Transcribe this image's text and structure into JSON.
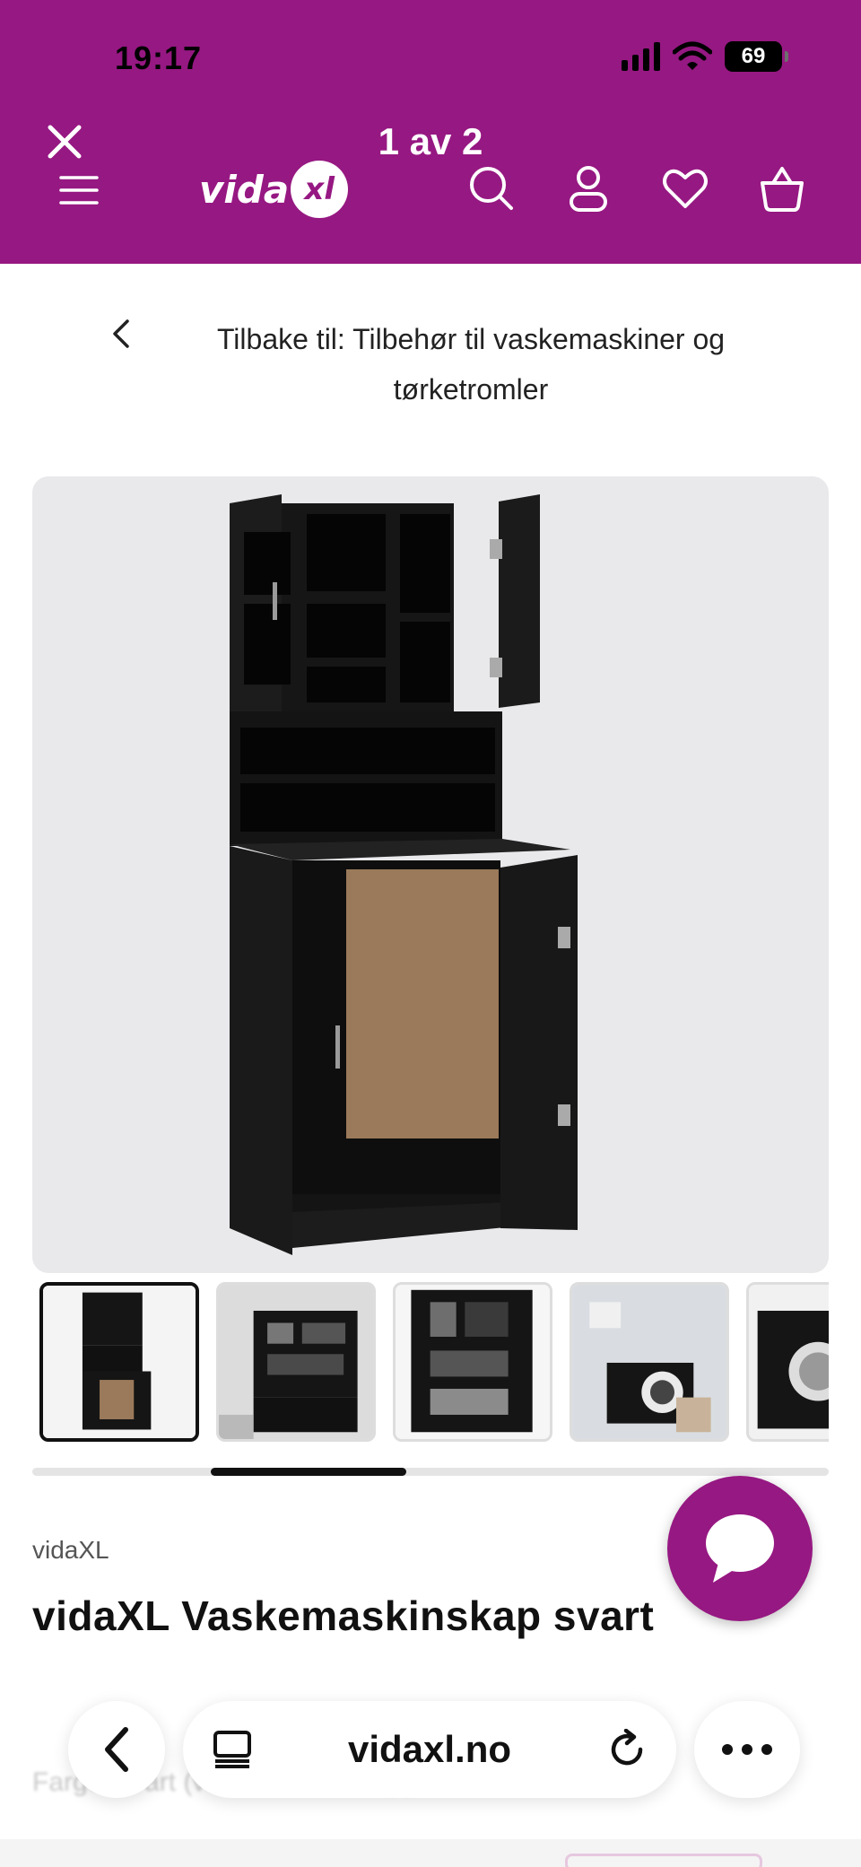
{
  "status_bar": {
    "time": "19:17",
    "battery": "69"
  },
  "header": {
    "gallery_counter": "1 av 2",
    "logo_text": "vida",
    "logo_badge": "xl"
  },
  "breadcrumb": {
    "back_text": "Tilbake til: Tilbehør til vaskemaskiner og tørketromler"
  },
  "product": {
    "brand": "vidaXL",
    "title": "vidaXL Vaskemaskinskap svart",
    "thumbnail_count": 5,
    "faded_text": "Farge: svart (vaskemaskinskap)"
  },
  "browser": {
    "url": "vidaxl.no"
  },
  "colors": {
    "brand_purple": "#961882",
    "image_bg": "#e9e9ec",
    "cabinet": "#161616",
    "back_panel": "#9a7a5a"
  },
  "icons": [
    "close-icon",
    "menu-icon",
    "search-icon",
    "account-icon",
    "heart-icon",
    "basket-icon",
    "chevron-left-icon",
    "chat-icon",
    "tabs-icon",
    "reload-icon",
    "more-icon"
  ]
}
